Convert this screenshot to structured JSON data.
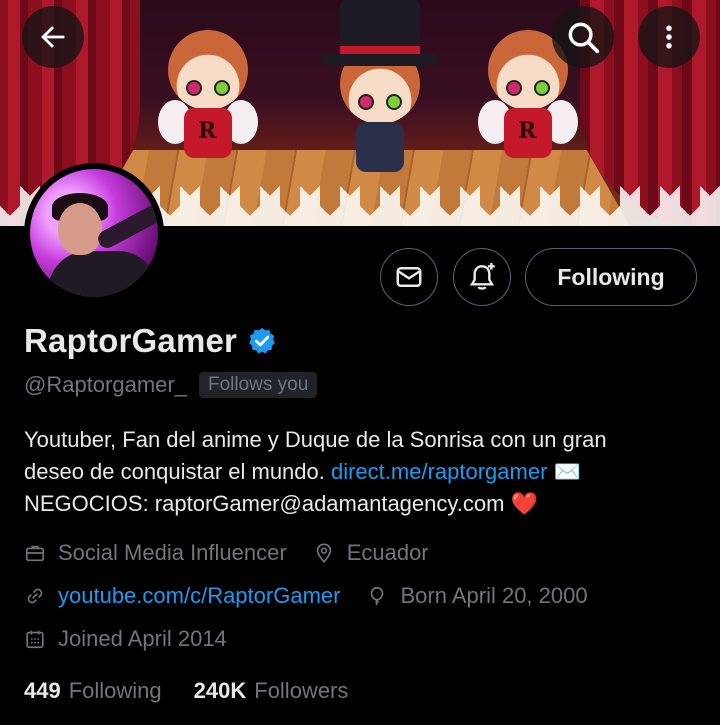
{
  "header": {
    "back_icon": "arrow-left-icon",
    "search_icon": "search-icon",
    "more_icon": "more-vertical-icon"
  },
  "profile": {
    "display_name": "RaptorGamer",
    "verified_icon": "verified-badge-icon",
    "verified_color": "#1d9bf0",
    "handle": "@Raptorgamer_",
    "follows_you": "Follows you"
  },
  "actions": {
    "message_icon": "envelope-icon",
    "notify_icon": "bell-plus-icon",
    "follow_label": "Following"
  },
  "bio": {
    "line1": "Youtuber, Fan del anime y Duque de la Sonrisa con un gran",
    "line2_text": "deseo de conquistar el mundo. ",
    "line2_link": "direct.me/raptorgamer",
    "line2_emoji": "✉️",
    "line3_text": "NEGOCIOS: raptorGamer@adamantagency.com ",
    "line3_emoji": "❤️"
  },
  "meta": {
    "category": "Social Media Influencer",
    "location": "Ecuador",
    "website": "youtube.com/c/RaptorGamer",
    "birthday": "Born April 20, 2000",
    "joined": "Joined April 2014"
  },
  "stats": {
    "following_count": "449",
    "following_label": "Following",
    "followers_count": "240K",
    "followers_label": "Followers"
  },
  "colors": {
    "background": "#000000",
    "primary_text": "#e7e9ea",
    "secondary_text": "#71767b",
    "link": "#1d9bf0",
    "border": "#536471"
  }
}
